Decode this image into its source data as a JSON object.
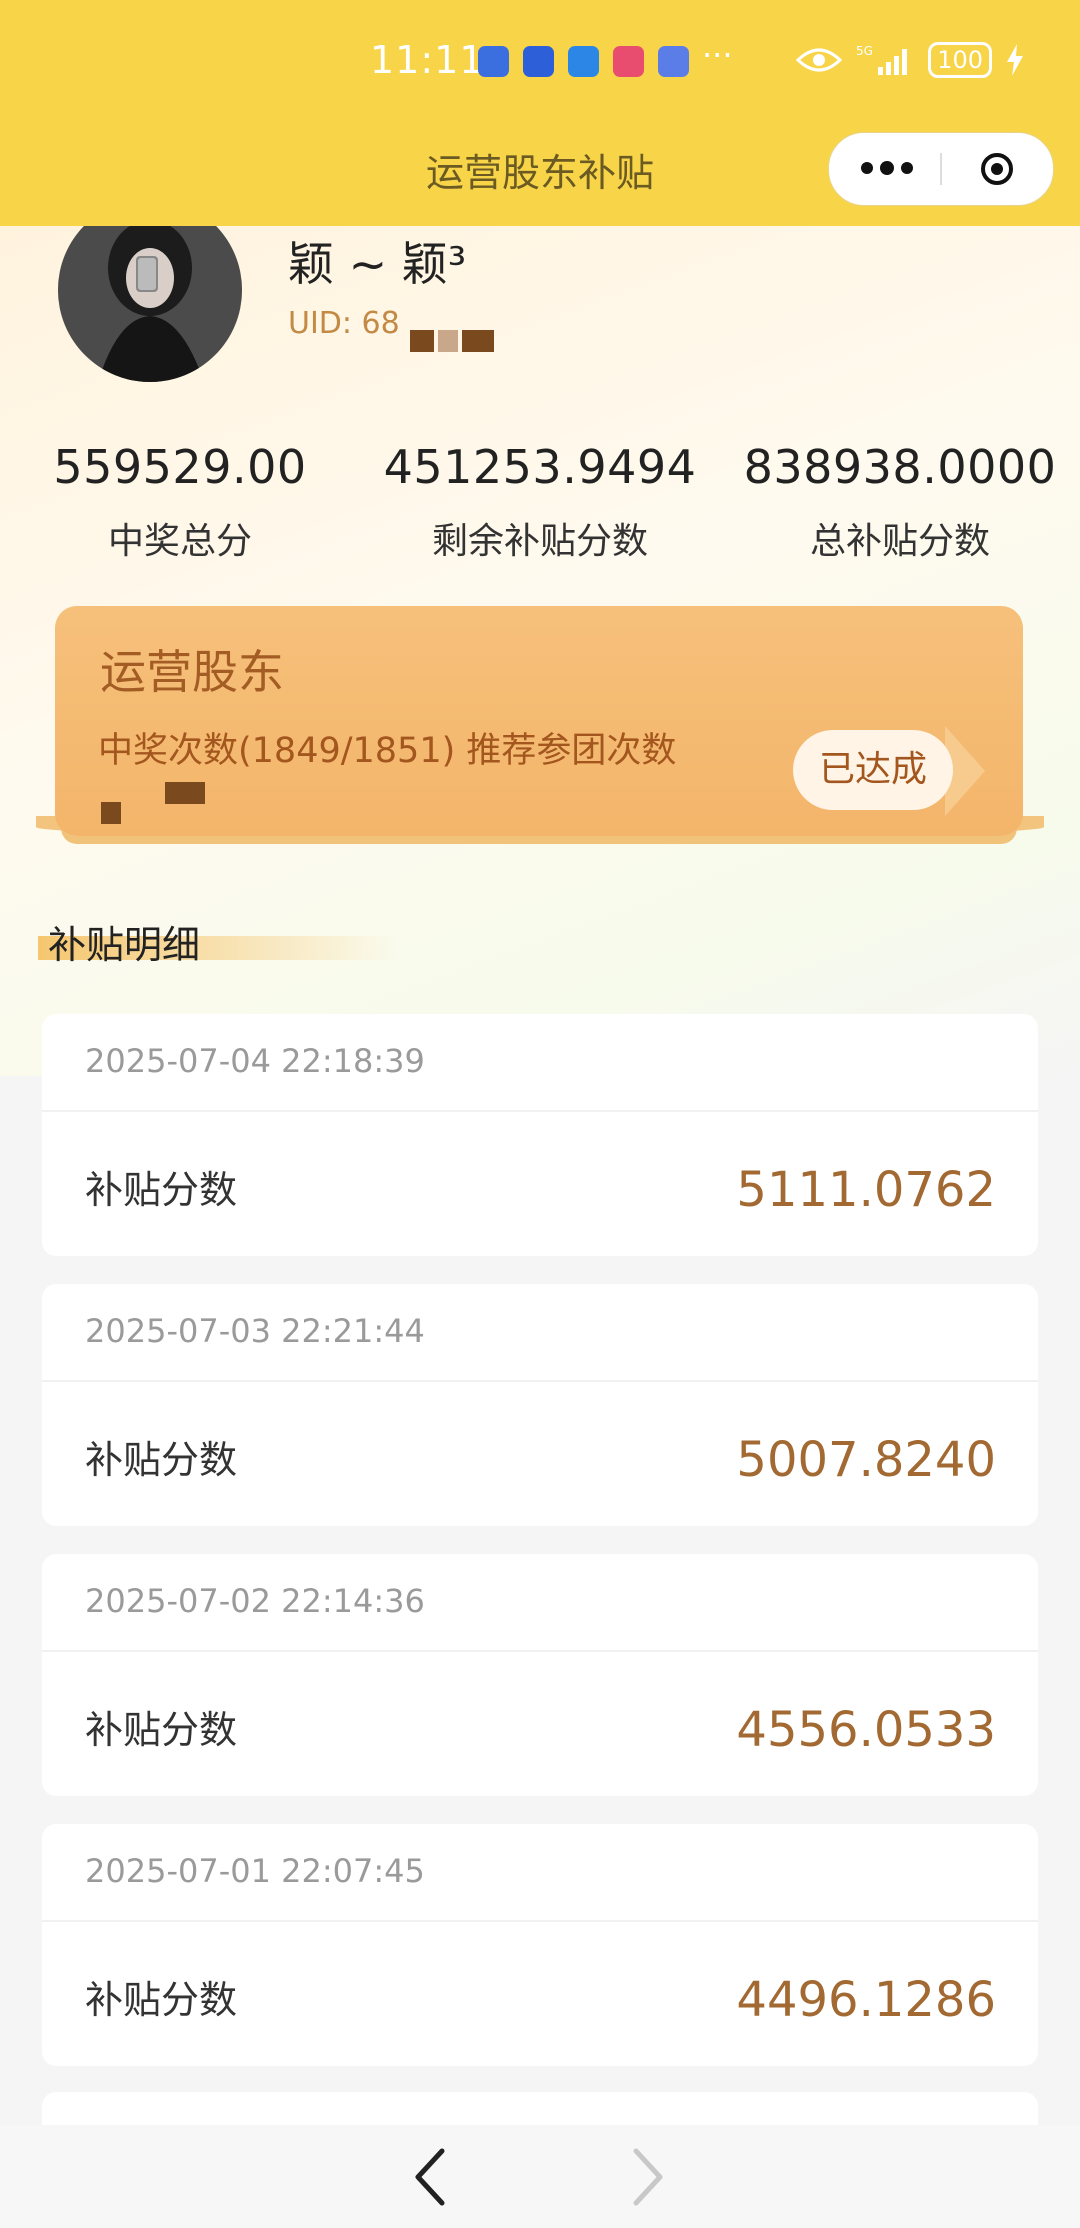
{
  "status_bar": {
    "time": "11:11",
    "more_dots": "···",
    "network": "5G",
    "battery": "100"
  },
  "header": {
    "title": "运营股东补贴"
  },
  "profile": {
    "nickname": "颖 ~ 颖³",
    "uid_label": "UID: 68"
  },
  "stats": [
    {
      "value": "559529.00",
      "label": "中奖总分"
    },
    {
      "value": "451253.9494",
      "label": "剩余补贴分数"
    },
    {
      "value": "838938.0000",
      "label": "总补贴分数"
    }
  ],
  "status_card": {
    "title": "运营股东",
    "description": "中奖次数(1849/1851) 推荐参团次数",
    "badge": "已达成"
  },
  "section": {
    "title": "补贴明细"
  },
  "details": [
    {
      "date": "2025-07-04 22:18:39",
      "label": "补贴分数",
      "value": "5111.0762"
    },
    {
      "date": "2025-07-03 22:21:44",
      "label": "补贴分数",
      "value": "5007.8240"
    },
    {
      "date": "2025-07-02 22:14:36",
      "label": "补贴分数",
      "value": "4556.0533"
    },
    {
      "date": "2025-07-01 22:07:45",
      "label": "补贴分数",
      "value": "4496.1286"
    }
  ],
  "colors": {
    "header_bg": "#f7d448",
    "card_bg": "#f3b56a",
    "value_color": "#a26a32"
  }
}
